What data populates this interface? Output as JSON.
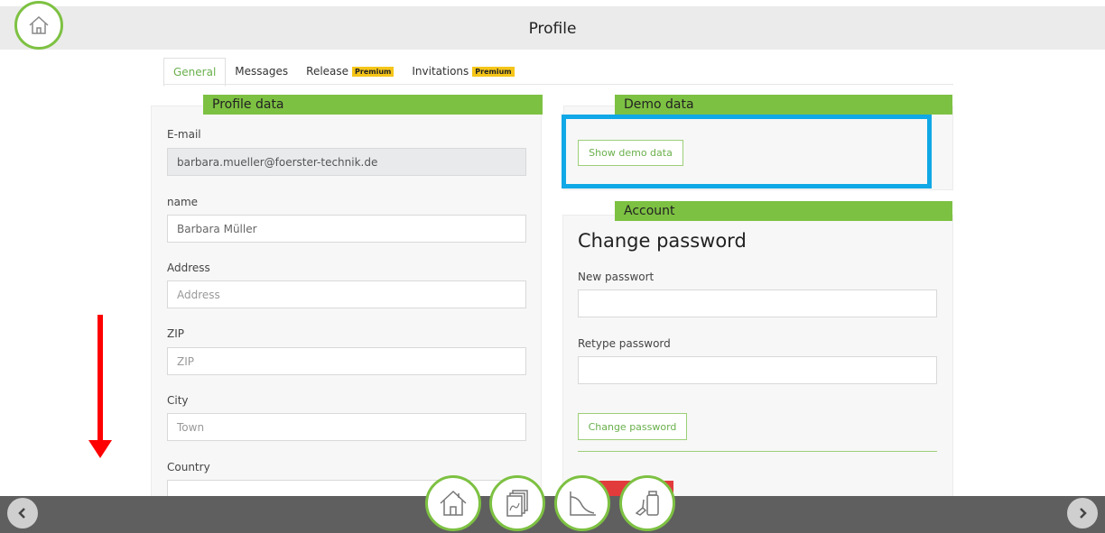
{
  "header": {
    "title": "Profile"
  },
  "tabs": [
    {
      "label": "General",
      "badge": ""
    },
    {
      "label": "Messages",
      "badge": ""
    },
    {
      "label": "Release",
      "badge": "Premium"
    },
    {
      "label": "Invitations",
      "badge": "Premium"
    }
  ],
  "profile": {
    "header": "Profile data",
    "email_label": "E-mail",
    "email_value": "barbara.mueller@foerster-technik.de",
    "name_label": "name",
    "name_value": "Barbara Müller",
    "address_label": "Address",
    "address_placeholder": "Address",
    "zip_label": "ZIP",
    "zip_placeholder": "ZIP",
    "city_label": "City",
    "city_placeholder": "Town",
    "country_label": "Country"
  },
  "demo": {
    "header": "Demo data",
    "button_label": "Show demo data"
  },
  "account": {
    "header": "Account",
    "title": "Change password",
    "new_label": "New passwort",
    "retype_label": "Retype password",
    "button_label": "Change password"
  },
  "colors": {
    "accent_green": "#7dc142",
    "highlight_blue": "#10a8e6",
    "annotation_red": "#ff0000",
    "premium_yellow": "#f5c518"
  },
  "icons": [
    "home-icon",
    "documents-icon",
    "chart-icon",
    "device-icon",
    "chevron-left-icon",
    "chevron-right-icon"
  ]
}
